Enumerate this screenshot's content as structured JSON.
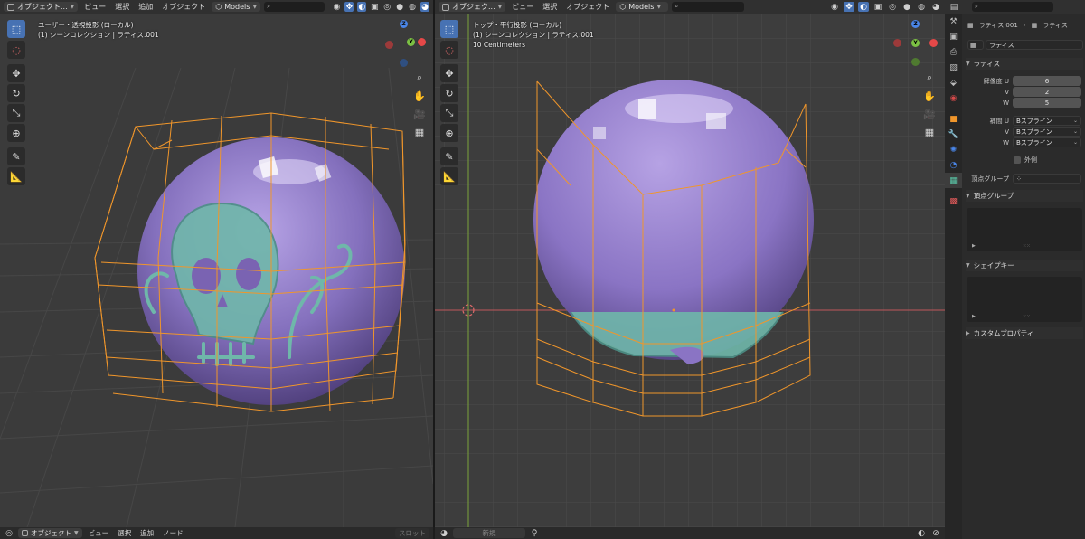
{
  "left_viewport": {
    "header": {
      "mode_label": "オブジェクト...",
      "menus": [
        "ビュー",
        "選択",
        "追加",
        "オブジェクト"
      ],
      "collection_dropdown": "Models"
    },
    "info_lines": [
      "ユーザー・透視投影 (ローカル)",
      "(1) シーンコレクション | ラティス.001"
    ],
    "toolbar_icons": [
      "select-box-icon",
      "cursor-icon",
      "move-icon",
      "rotate-icon",
      "scale-icon",
      "transform-icon",
      "annotate-icon",
      "measure-icon"
    ],
    "gizmo_labels": {
      "z": "Z",
      "y": "Y"
    }
  },
  "right_viewport": {
    "header": {
      "mode_label": "オブジェク...",
      "menus": [
        "ビュー",
        "選択",
        "オブジェクト"
      ],
      "collection_dropdown": "Models"
    },
    "info_lines": [
      "トップ・平行投影 (ローカル)",
      "(1) シーンコレクション | ラティス.001",
      "10 Centimeters"
    ],
    "gizmo_labels": {
      "z": "Z",
      "y": "Y"
    }
  },
  "properties": {
    "object_name": "ラティス.001",
    "data_name": "ラティス",
    "datablock_name": "ラティス",
    "lattice_panel_title": "ラティス",
    "resolution_label": "解像度 U",
    "resolution": [
      {
        "axis": "U",
        "value": "6"
      },
      {
        "axis": "V",
        "value": "2"
      },
      {
        "axis": "W",
        "value": "5"
      }
    ],
    "interp_label": "補間 U",
    "interpolation": [
      {
        "axis": "U",
        "value": "Bスプライン"
      },
      {
        "axis": "V",
        "value": "Bスプライン"
      },
      {
        "axis": "W",
        "value": "Bスプライン"
      }
    ],
    "outside_label": "外側",
    "vertex_group_label": "頂点グループ",
    "vertex_groups_panel": "頂点グループ",
    "shape_keys_panel": "シェイプキー",
    "custom_props_panel": "カスタムプロパティ"
  },
  "bottom_bar": {
    "mode_label": "オブジェクト",
    "menus": [
      "ビュー",
      "選択",
      "追加",
      "ノード"
    ],
    "slot_label": "スロット",
    "new_label": "新規"
  },
  "colors": {
    "accent": "#4772b3",
    "lattice": "#f0962b",
    "sphere": "#8a72c4",
    "emboss": "#6fb7aa"
  }
}
